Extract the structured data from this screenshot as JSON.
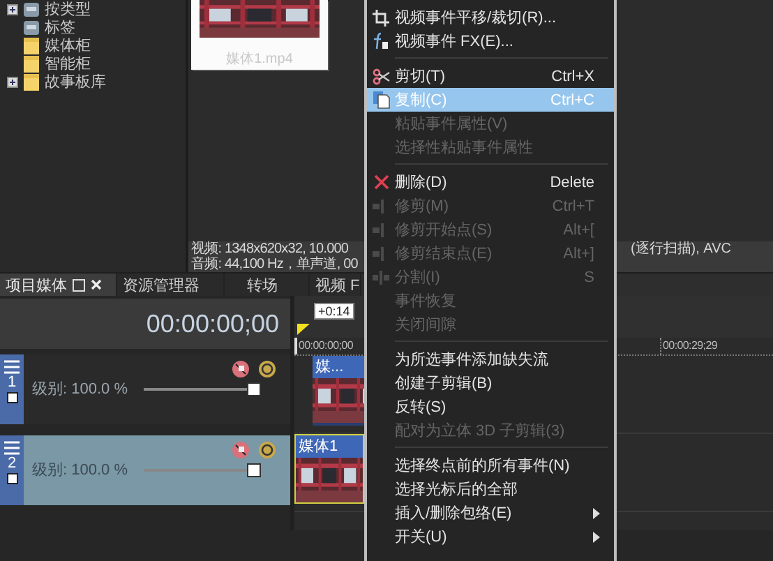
{
  "tree": [
    {
      "label": "按类型",
      "expandable": true,
      "kind": "drive"
    },
    {
      "label": "标签",
      "expandable": false,
      "kind": "drive"
    },
    {
      "label": "媒体柜",
      "expandable": false,
      "kind": "folder"
    },
    {
      "label": "智能柜",
      "expandable": false,
      "kind": "folder"
    },
    {
      "label": "故事板库",
      "expandable": true,
      "kind": "folder"
    }
  ],
  "media": {
    "file": "媒体1.mp4",
    "info_video": "视频: 1348x620x32, 10.000",
    "info_video_tail": "(逐行扫描), AVC",
    "info_audio": "音频: 44,100 Hz，单声道, 00"
  },
  "tabs": [
    {
      "label": "项目媒体",
      "selected": true
    },
    {
      "label": "资源管理器",
      "selected": false
    },
    {
      "label": "转场",
      "selected": false
    },
    {
      "label": "视频 F",
      "selected": false
    }
  ],
  "time": "00:00:00;00",
  "tracks": [
    {
      "number": "1",
      "level_label": "级别: 100.0 %",
      "level": 1.0,
      "selected": false,
      "event": "媒..."
    },
    {
      "number": "2",
      "level_label": "级别: 100.0 %",
      "level": 1.0,
      "selected": true,
      "event": "媒体1"
    }
  ],
  "timeline": {
    "cursor_offset": "+0:14",
    "start": "00:00:00;00",
    "end_marker": "00:00:29;29"
  },
  "menu": [
    [
      {
        "label": "视频事件平移/裁切(R)...",
        "kind": "crop",
        "disabled": false,
        "selected": false
      },
      {
        "label": "视频事件 FX(E)...",
        "kind": "fx",
        "disabled": false,
        "selected": false
      }
    ],
    [
      {
        "label": "剪切(T)",
        "shortcut": "Ctrl+X",
        "kind": "scissors",
        "disabled": false,
        "selected": false
      },
      {
        "label": "复制(C)",
        "shortcut": "Ctrl+C",
        "kind": "copy",
        "disabled": false,
        "selected": true
      },
      {
        "label": "粘贴事件属性(V)",
        "disabled": true,
        "selected": false
      },
      {
        "label": "选择性粘贴事件属性",
        "disabled": true,
        "selected": false
      }
    ],
    [
      {
        "label": "删除(D)",
        "shortcut": "Delete",
        "kind": "delete",
        "disabled": false,
        "selected": false
      },
      {
        "label": "修剪(M)",
        "shortcut": "Ctrl+T",
        "kind": "trim",
        "disabled": true,
        "selected": false
      },
      {
        "label": "修剪开始点(S)",
        "shortcut": "Alt+[",
        "kind": "trim",
        "disabled": true,
        "selected": false
      },
      {
        "label": "修剪结束点(E)",
        "shortcut": "Alt+]",
        "kind": "trim",
        "disabled": true,
        "selected": false
      },
      {
        "label": "分割(I)",
        "shortcut": "S",
        "kind": "split",
        "disabled": true,
        "selected": false
      },
      {
        "label": "事件恢复",
        "disabled": true,
        "selected": false
      },
      {
        "label": "关闭间隙",
        "disabled": true,
        "selected": false
      }
    ],
    [
      {
        "label": "为所选事件添加缺失流",
        "disabled": false,
        "selected": false
      },
      {
        "label": "创建子剪辑(B)",
        "disabled": false,
        "selected": false
      },
      {
        "label": "反转(S)",
        "disabled": false,
        "selected": false
      },
      {
        "label": "配对为立体 3D 子剪辑(3)",
        "disabled": true,
        "selected": false
      }
    ],
    [
      {
        "label": "选择终点前的所有事件(N)",
        "disabled": false,
        "selected": false
      },
      {
        "label": "选择光标后的全部",
        "disabled": false,
        "selected": false
      },
      {
        "label": "插入/删除包络(E)",
        "submenu": true,
        "disabled": false,
        "selected": false
      },
      {
        "label": "开关(U)",
        "submenu": true,
        "disabled": false,
        "selected": false
      }
    ]
  ]
}
